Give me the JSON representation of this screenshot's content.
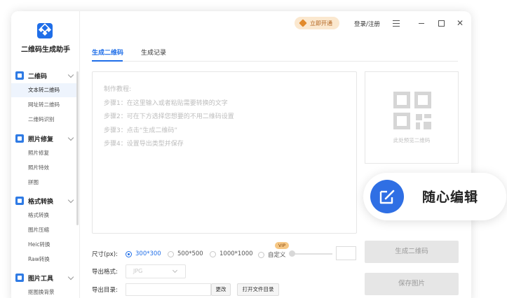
{
  "app": {
    "name": "二维码生成助手",
    "vip_label": "立即开通",
    "login_label": "登录/注册"
  },
  "sidebar": {
    "groups": [
      {
        "label": "二维码",
        "items": [
          "文本转二维码",
          "网址转二维码",
          "二维码识别"
        ]
      },
      {
        "label": "照片修复",
        "items": [
          "照片修复",
          "照片特效",
          "拼图"
        ]
      },
      {
        "label": "格式转换",
        "items": [
          "格式转换",
          "图片压缩",
          "Heic转换",
          "Raw转换"
        ]
      },
      {
        "label": "图片工具",
        "items": [
          "抠图换背景"
        ]
      }
    ],
    "active_item": "文本转二维码"
  },
  "tabs": [
    {
      "label": "生成二维码",
      "active": true
    },
    {
      "label": "生成记录",
      "active": false
    }
  ],
  "textarea": {
    "lines": [
      "制作教程:",
      "步骤1：在这里输入或者粘贴需要转换的文字",
      "步骤2：可在下方选择您想要的不用二维码设置",
      "步骤3：点击“生成二维码”",
      "步骤4：设置导出类型并保存"
    ]
  },
  "preview": {
    "label": "此处预览二维码"
  },
  "size": {
    "label": "尺寸(px):",
    "options": [
      "300*300",
      "500*500",
      "1000*1000",
      "自定义"
    ],
    "selected": "300*300",
    "vip_tag": "VIP"
  },
  "format": {
    "label": "导出格式:",
    "value": "JPG"
  },
  "directory": {
    "label": "导出目录:",
    "change_label": "更改",
    "open_label": "打开文件目录"
  },
  "buttons": {
    "generate": "生成二维码",
    "save": "保存图片"
  },
  "badge": {
    "text": "随心编辑"
  },
  "colors": {
    "accent": "#1f6ee8",
    "vip_bg": "#fbe8cf",
    "vip_text": "#b2621c"
  }
}
